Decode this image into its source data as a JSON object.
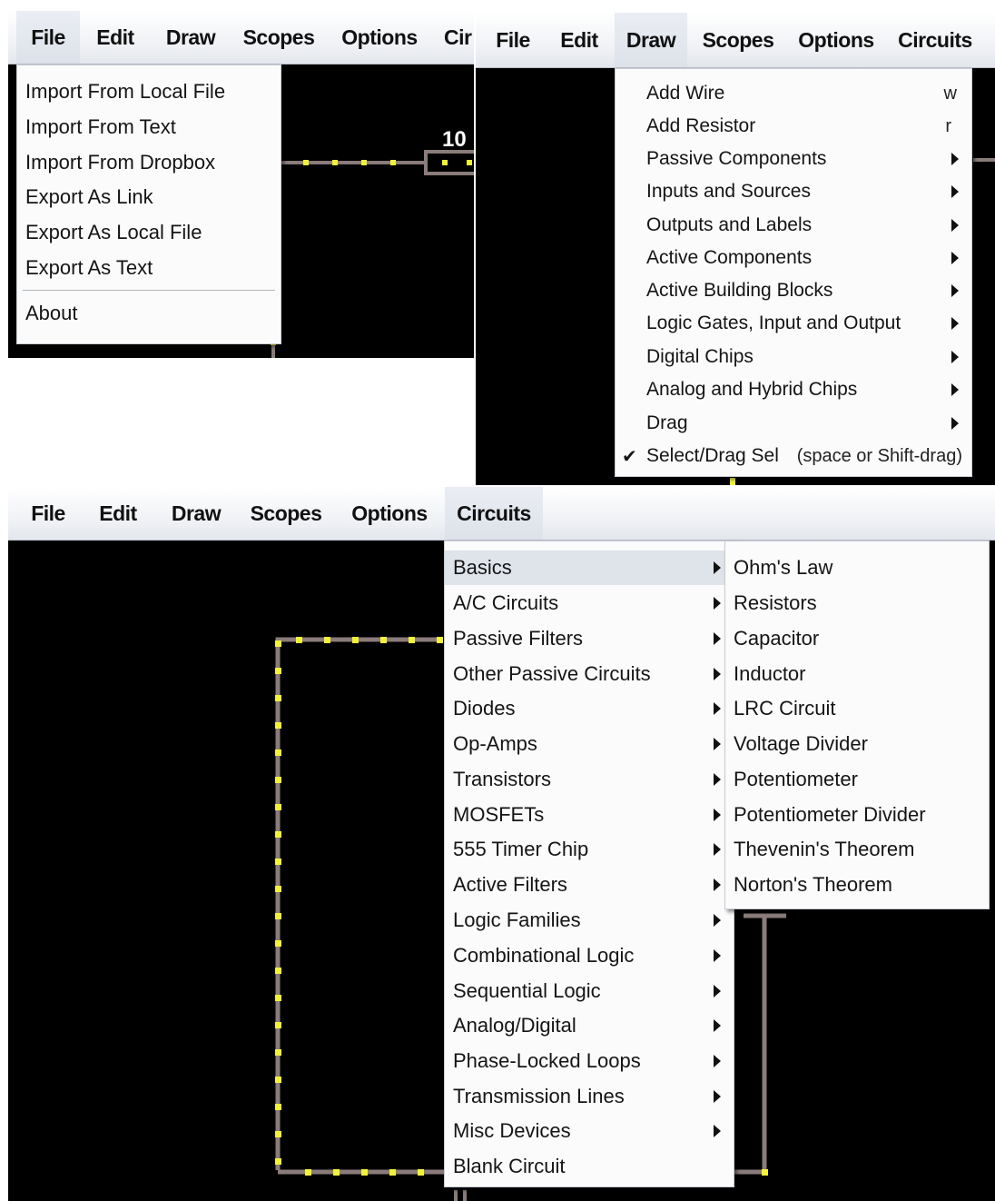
{
  "menubar": {
    "file": "File",
    "edit": "Edit",
    "draw": "Draw",
    "scopes": "Scopes",
    "options": "Options",
    "circuits": "Circuits",
    "circuits_truncated": "Cir"
  },
  "file_menu": {
    "items": [
      "Import From Local File",
      "Import From Text",
      "Import From Dropbox",
      "Export As Link",
      "Export As Local File",
      "Export As Text"
    ],
    "about": "About"
  },
  "canvas_label": "10",
  "draw_menu": {
    "items": [
      {
        "label": "Add Wire",
        "shortcut": "w",
        "submenu": false
      },
      {
        "label": "Add Resistor",
        "shortcut": "r",
        "submenu": false
      },
      {
        "label": "Passive Components",
        "shortcut": "",
        "submenu": true
      },
      {
        "label": "Inputs and Sources",
        "shortcut": "",
        "submenu": true
      },
      {
        "label": "Outputs and Labels",
        "shortcut": "",
        "submenu": true
      },
      {
        "label": "Active Components",
        "shortcut": "",
        "submenu": true
      },
      {
        "label": "Active Building Blocks",
        "shortcut": "",
        "submenu": true
      },
      {
        "label": "Logic Gates, Input and Output",
        "shortcut": "",
        "submenu": true
      },
      {
        "label": "Digital Chips",
        "shortcut": "",
        "submenu": true
      },
      {
        "label": "Analog and Hybrid Chips",
        "shortcut": "",
        "submenu": true
      },
      {
        "label": "Drag",
        "shortcut": "",
        "submenu": true
      }
    ],
    "checked_item": {
      "check": "✔",
      "label": "Select/Drag Sel",
      "shortcut": "(space or Shift-drag)"
    }
  },
  "circuits_menu": {
    "items": [
      "Basics",
      "A/C Circuits",
      "Passive Filters",
      "Other Passive Circuits",
      "Diodes",
      "Op-Amps",
      "Transistors",
      "MOSFETs",
      "555 Timer Chip",
      "Active Filters",
      "Logic Families",
      "Combinational Logic",
      "Sequential Logic",
      "Analog/Digital",
      "Phase-Locked Loops",
      "Transmission Lines",
      "Misc Devices"
    ],
    "last": "Blank Circuit",
    "highlighted": "Basics"
  },
  "basics_submenu": {
    "items": [
      "Ohm's Law",
      "Resistors",
      "Capacitor",
      "Inductor",
      "LRC Circuit",
      "Voltage Divider",
      "Potentiometer",
      "Potentiometer Divider",
      "Thevenin's Theorem",
      "Norton's Theorem"
    ]
  },
  "colors": {
    "canvas": "#000000",
    "wire": "#8a7c7a",
    "wire_dot": "#f2f23a",
    "menu_bg": "#fbfbfb",
    "highlight": "#dfe3ea"
  }
}
